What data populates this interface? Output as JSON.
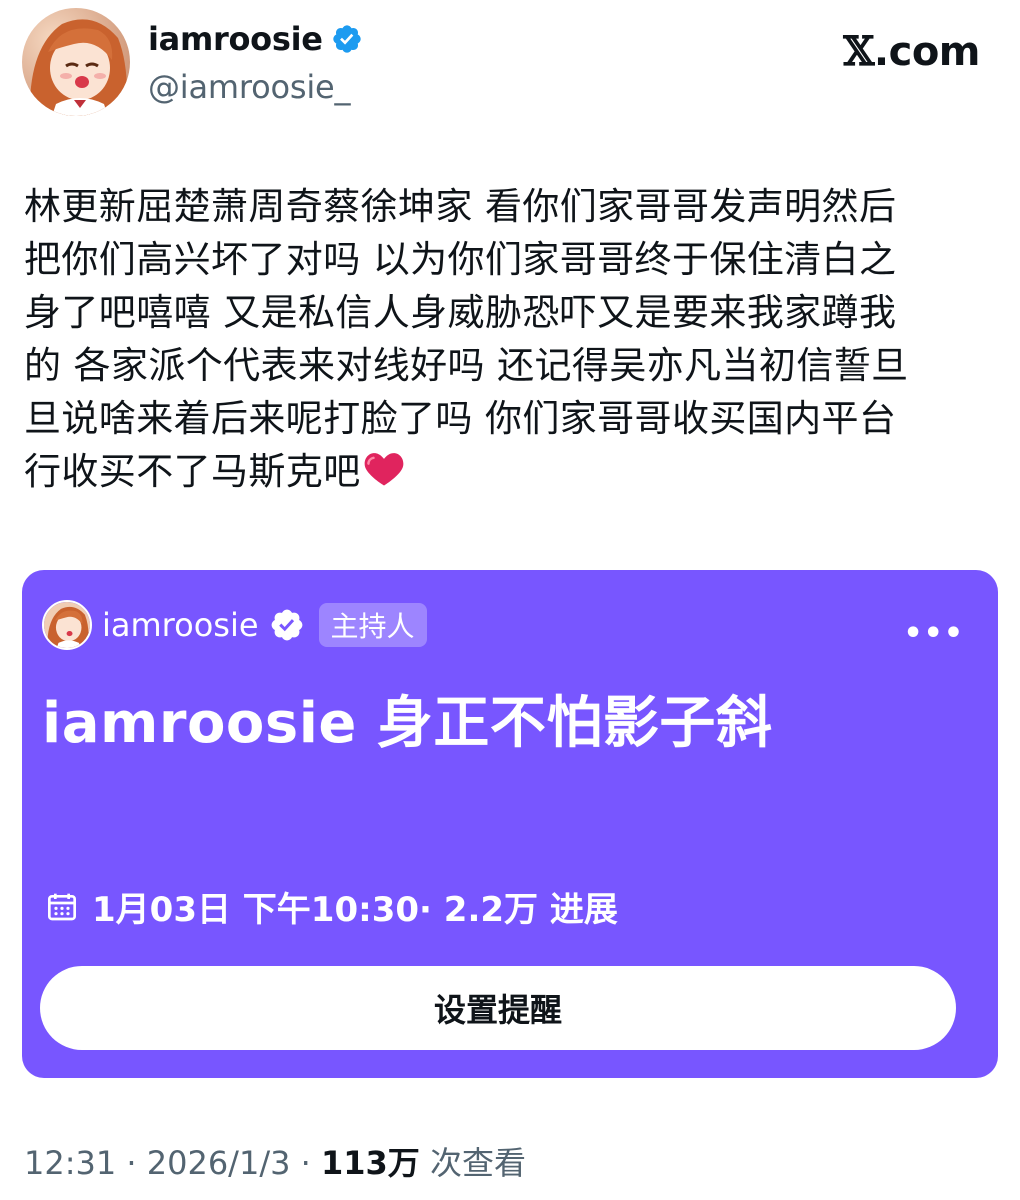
{
  "tweet": {
    "author": {
      "display_name": "iamroosie",
      "handle": "@iamroosie_",
      "verified": true,
      "avatar_icon": "anime-avatar-icon"
    },
    "brand": {
      "x_mark": "𝕏",
      "suffix": ".com"
    },
    "text_lines": [
      "林更新屈楚萧周奇蔡徐坤家 看你们家哥哥发声明然后",
      "把你们高兴坏了对吗 以为你们家哥哥终于保住清白之",
      "身了吧嘻嘻 又是私信人身威胁恐吓又是要来我家蹲我",
      "的 各家派个代表来对线好吗 还记得吴亦凡当初信誓旦",
      "旦说啥来着后来呢打脸了吗 你们家哥哥收买国内平台",
      "行收买不了马斯克吧"
    ],
    "emoji": "heart-icon",
    "meta": {
      "time": "12:31",
      "sep1": " · ",
      "date": "2026/1/3",
      "sep2": " · ",
      "views": "113万",
      "views_label": " 次查看"
    }
  },
  "space_card": {
    "host_name": "iamroosie",
    "host_badge": "主持人",
    "more": "•••",
    "title": "iamroosie 身正不怕影子斜",
    "schedule": "1月03日 下午10:30· 2.2万 进展",
    "reminder_button": "设置提醒"
  },
  "colors": {
    "card_bg": "#7856ff",
    "verified_blue": "#1d9bf0",
    "text_primary": "#0f1419",
    "text_secondary": "#536471"
  }
}
